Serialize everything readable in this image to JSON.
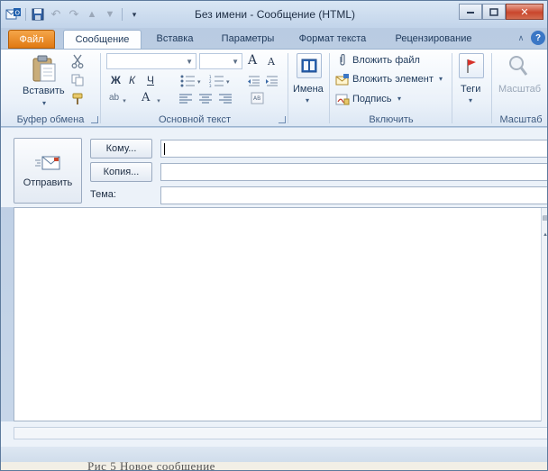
{
  "window": {
    "title": "Без имени  -  Сообщение (HTML)"
  },
  "colors": {
    "file_tab": "#e07913",
    "ribbon_text": "#1e395b",
    "close_button": "#c9462c"
  },
  "tabs": [
    {
      "label": "Файл"
    },
    {
      "label": "Сообщение",
      "active": true
    },
    {
      "label": "Вставка"
    },
    {
      "label": "Параметры"
    },
    {
      "label": "Формат текста"
    },
    {
      "label": "Рецензирование"
    }
  ],
  "ribbon": {
    "clipboard": {
      "label": "Буфер обмена",
      "paste": "Вставить",
      "icons": [
        "paste-icon",
        "cut-icon",
        "copy-icon",
        "format-painter-icon"
      ]
    },
    "basic_text": {
      "label": "Основной текст",
      "font_name": "",
      "font_size": "",
      "bold": "Ж",
      "italic": "К",
      "underline": "Ч",
      "grow_font": "A",
      "shrink_font": "A",
      "font_color": "A",
      "highlight": "ab"
    },
    "names": {
      "label": "Имена"
    },
    "include": {
      "label": "Включить",
      "attach_file": "Вложить файл",
      "attach_item": "Вложить элемент",
      "signature": "Подпись"
    },
    "tags": {
      "label": "Теги"
    },
    "zoom": {
      "label": "Масштаб",
      "button": "Масштаб"
    }
  },
  "compose": {
    "send": "Отправить",
    "to": "Кому...",
    "cc": "Копия...",
    "subject_label": "Тема:",
    "to_value": "",
    "cc_value": "",
    "subject_value": ""
  },
  "caption": "Рис 5 Новое сообщение"
}
